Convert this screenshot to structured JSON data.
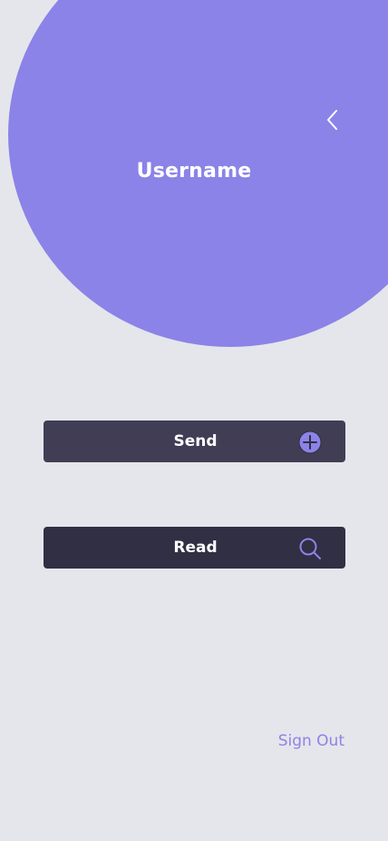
{
  "profile": {
    "username": "Username"
  },
  "actions": {
    "send_label": "Send",
    "read_label": "Read"
  },
  "footer": {
    "sign_out_label": "Sign Out"
  },
  "icons": {
    "back": "chevron-left-icon",
    "send": "plus-circle-icon",
    "read": "search-icon"
  },
  "colors": {
    "accent": "#8b83e7",
    "background": "#e5e6eb",
    "send_button": "#403d55",
    "read_button": "#302f43",
    "text_light": "#ffffff"
  }
}
